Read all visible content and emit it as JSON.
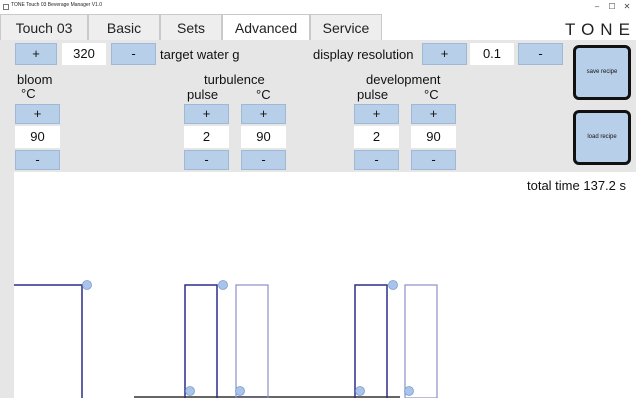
{
  "window": {
    "title": "TONE Touch 03   Beverage Manager   V1.0",
    "minimize": "–",
    "maximize": "☐",
    "close": "✕"
  },
  "tabs": [
    {
      "label": "Touch 03"
    },
    {
      "label": "Basic"
    },
    {
      "label": "Sets"
    },
    {
      "label": "Advanced"
    },
    {
      "label": "Service"
    }
  ],
  "brand": "TONE",
  "water": {
    "plus": "+",
    "value": "320",
    "minus": "-",
    "label": "target water g"
  },
  "resolution": {
    "label": "display resolution",
    "plus": "+",
    "value": "0.1",
    "minus": "-"
  },
  "bloom": {
    "title": "bloom",
    "unit": "°C",
    "plus": "+",
    "value": "90",
    "minus": "-"
  },
  "turbulence": {
    "title": "turbulence",
    "pulse": {
      "label": "pulse",
      "plus": "+",
      "value": "2",
      "minus": "-"
    },
    "temp": {
      "label": "°C",
      "plus": "+",
      "value": "90",
      "minus": "-"
    }
  },
  "development": {
    "title": "development",
    "pulse": {
      "label": "pulse",
      "plus": "+",
      "value": "2",
      "minus": "-"
    },
    "temp": {
      "label": "°C",
      "plus": "+",
      "value": "90",
      "minus": "-"
    }
  },
  "actions": {
    "save": "save recipe",
    "load": "load recipe"
  },
  "chart": {
    "total_label": "total time 137.2 s"
  },
  "colors": {
    "panel": "#e6e6e6",
    "button": "#b7cfe9",
    "pulse_dark": "#2b2f8c",
    "pulse_light": "#8c8fc9",
    "marker": "#a8c4ea"
  }
}
